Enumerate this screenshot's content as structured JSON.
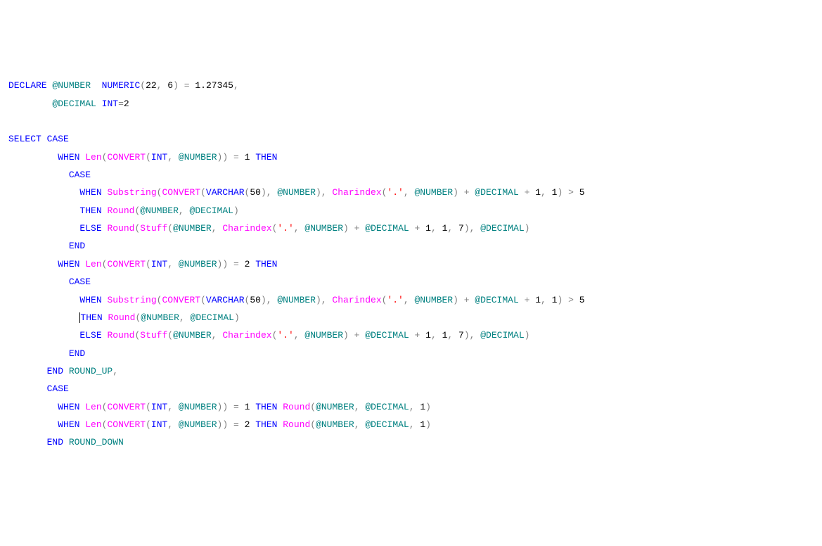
{
  "code": {
    "declare": "DECLARE",
    "number_var": "@NUMBER",
    "numeric_type": "NUMERIC",
    "numeric_p1": "22",
    "numeric_p2": "6",
    "eq": "=",
    "number_val": "1.27345",
    "decimal_var": "@DECIMAL",
    "int_type": "INT",
    "decimal_val": "2",
    "select": "SELECT",
    "case": "CASE",
    "when": "WHEN",
    "then": "THEN",
    "else": "ELSE",
    "end": "END",
    "len": "Len",
    "convert": "CONVERT",
    "substring": "Substring",
    "varchar": "VARCHAR",
    "varchar_len": "50",
    "charindex": "Charindex",
    "dot_str": "'.'",
    "round": "Round",
    "stuff": "Stuff",
    "one": "1",
    "two": "2",
    "five": "5",
    "seven": "7",
    "plus": "+",
    "gt": ">",
    "comma": ",",
    "op": "(",
    "cp": ")",
    "round_up": "ROUND_UP",
    "round_down": "ROUND_DOWN"
  }
}
